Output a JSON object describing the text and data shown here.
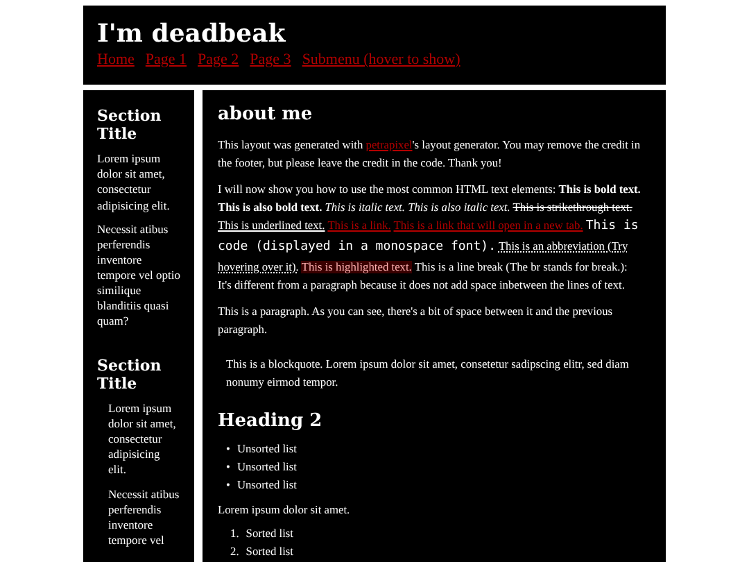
{
  "header": {
    "title": "I'm deadbeak",
    "nav": [
      "Home",
      "Page 1",
      "Page 2",
      "Page 3",
      "Submenu (hover to show)"
    ]
  },
  "sidebar": {
    "sections": [
      {
        "kind": "plain",
        "title": "Section Title",
        "paragraphs": [
          "Lorem ipsum dolor sit amet, consectetur adipisicing elit.",
          "Necessit atibus perferendis inventore tempore vel optio similique blanditiis quasi quam?"
        ]
      },
      {
        "kind": "quote",
        "title": "Section Title",
        "paragraphs": [
          "Lorem ipsum dolor sit amet, consectetur adipisicing elit.",
          "Necessit atibus perferendis inventore tempore vel"
        ]
      }
    ]
  },
  "main": {
    "heading": "about me",
    "intro": [
      {
        "kind": "text",
        "text": "This layout was generated with "
      },
      {
        "kind": "link",
        "text": "petrapixel"
      },
      {
        "kind": "text",
        "text": "'s layout generator. You may remove the credit in the footer, but please leave the credit in the code. Thank you!"
      }
    ],
    "elements": [
      {
        "kind": "text",
        "text": "I will now show you how to use the most common HTML text elements:"
      },
      {
        "kind": "bold",
        "text": "This is bold text."
      },
      {
        "kind": "bold",
        "text": "This is also bold text."
      },
      {
        "kind": "italic",
        "text": "This is italic text."
      },
      {
        "kind": "italic",
        "text": "This is also italic text."
      },
      {
        "kind": "strike",
        "text": "This is strikethrough text."
      },
      {
        "kind": "underline",
        "text": "This is underlined text."
      },
      {
        "kind": "link",
        "text": "This is a link."
      },
      {
        "kind": "link",
        "text": "This is a link that will open in a new tab."
      },
      {
        "kind": "code",
        "text": "This is code (displayed in a monospace font)."
      },
      {
        "kind": "abbr",
        "text": "This is an abbreviation (Try hovering over it)."
      },
      {
        "kind": "mark",
        "text": "This is highlighted text."
      },
      {
        "kind": "text",
        "text": "This is a line break (The br stands for break.):"
      },
      {
        "kind": "break"
      },
      {
        "kind": "text",
        "text": "It's different from a paragraph because it does not add space inbetween the lines of text."
      }
    ],
    "paragraph": "This is a paragraph. As you can see, there's a bit of space between it and the previous paragraph.",
    "blockquote": "This is a blockquote. Lorem ipsum dolor sit amet, consetetur sadipscing elitr, sed diam nonumy eirmod tempor.",
    "heading2": "Heading 2",
    "unordered": [
      {
        "marker": "•",
        "text": "Unsorted list"
      },
      {
        "marker": "•",
        "text": "Unsorted list"
      },
      {
        "marker": "•",
        "text": "Unsorted list"
      }
    ],
    "after_list": "Lorem ipsum dolor sit amet.",
    "ordered": [
      {
        "marker": "1.",
        "text": "Sorted list"
      },
      {
        "marker": "2.",
        "text": "Sorted list"
      }
    ]
  }
}
